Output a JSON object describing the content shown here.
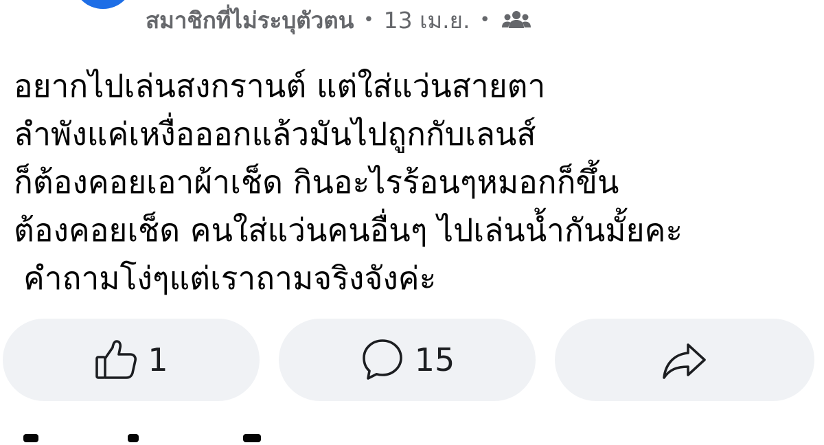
{
  "post": {
    "author": "สมาชิกที่ไม่ระบุตัวตน",
    "separator": "•",
    "date": "13 เม.ย.",
    "audience_icon": "group-icon",
    "body_lines": [
      "อยากไปเล่นสงกรานต์  แต่ใส่แว่นสายตา",
      "ลำพังแค่เหงื่อออกแล้วมันไปถูกกับเลนส์",
      "ก็ต้องคอยเอาผ้าเช็ด กินอะไรร้อนๆหมอกก็ขึ้น",
      "ต้องคอยเช็ด คนใส่แว่นคนอื่นๆ ไปเล่นน้ำกันมั้ยคะ",
      "คำถามโง่ๆแต่เราถามจริงจังค่ะ"
    ]
  },
  "actions": {
    "like": {
      "icon": "thumbs-up-icon",
      "count": "1"
    },
    "comment": {
      "icon": "comment-icon",
      "count": "15"
    },
    "share": {
      "icon": "share-arrow-icon"
    }
  },
  "colors": {
    "avatar_blue": "#1e6ee6",
    "avatar_green": "#3f7f62",
    "meta_gray": "#65676b",
    "button_bg": "#f0f2f5",
    "text": "#050505"
  }
}
